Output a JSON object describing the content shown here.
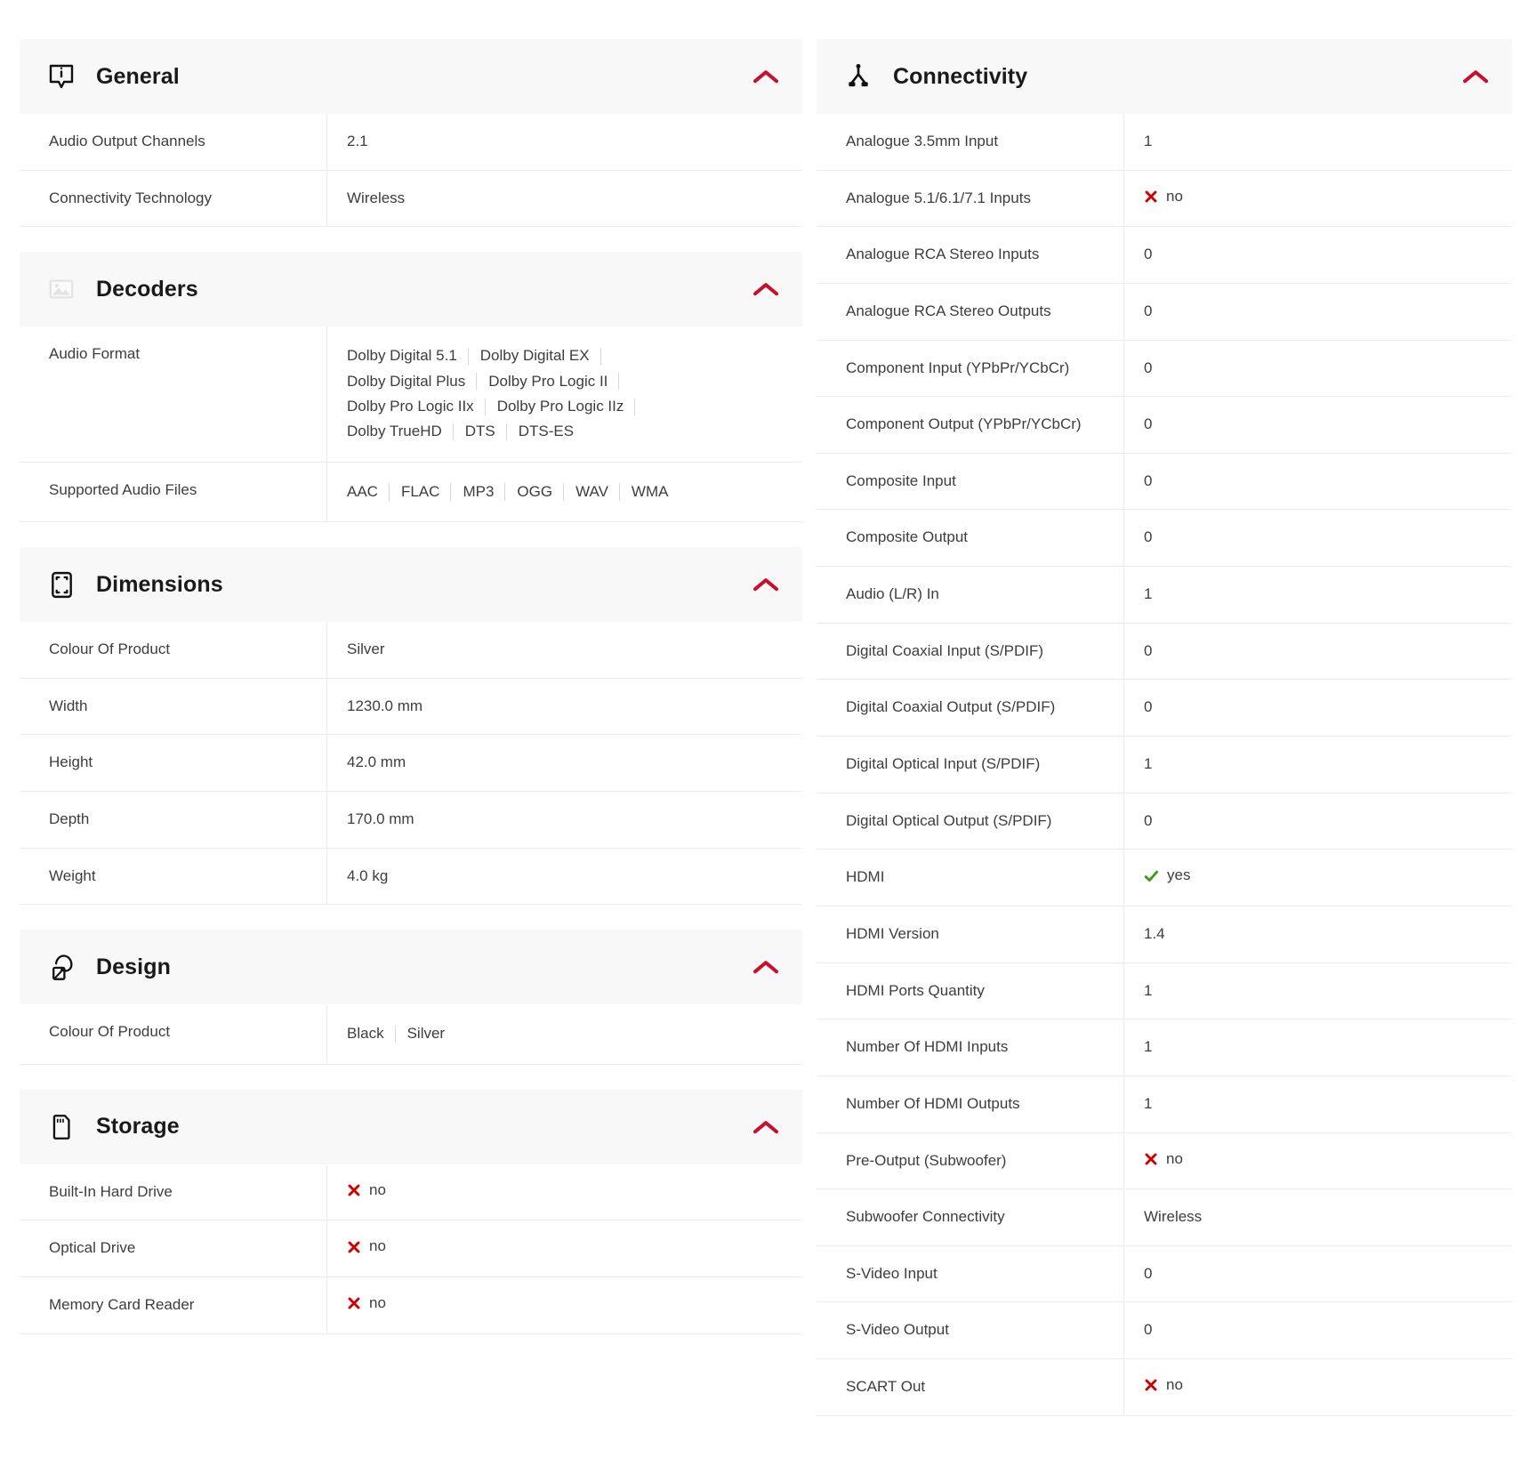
{
  "colors": {
    "accent_red": "#c8102e",
    "no_red": "#cc0000",
    "yes_green": "#3d9c1e",
    "header_bg": "#f8f8f8",
    "text": "#3d3d3d",
    "title": "#1a1a1a",
    "divider": "#ececec"
  },
  "labels": {
    "yes": "yes",
    "no": "no"
  },
  "left_column": [
    {
      "id": "general",
      "title": "General",
      "icon": "info-tooltip-icon",
      "collapse_icon": "chevron-up-icon",
      "rows": [
        {
          "label": "Audio Output Channels",
          "value": "2.1",
          "type": "text"
        },
        {
          "label": "Connectivity Technology",
          "value": "Wireless",
          "type": "text"
        }
      ]
    },
    {
      "id": "decoders",
      "title": "Decoders",
      "icon": "image-placeholder-icon",
      "collapse_icon": "chevron-up-icon",
      "rows": [
        {
          "label": "Audio Format",
          "type": "multi",
          "values": [
            "Dolby Digital 5.1",
            "Dolby Digital EX",
            "Dolby Digital Plus",
            "Dolby Pro Logic II",
            "Dolby Pro Logic IIx",
            "Dolby Pro Logic IIz",
            "Dolby TrueHD",
            "DTS",
            "DTS-ES"
          ]
        },
        {
          "label": "Supported Audio Files",
          "type": "multi",
          "values": [
            "AAC",
            "FLAC",
            "MP3",
            "OGG",
            "WAV",
            "WMA"
          ]
        }
      ]
    },
    {
      "id": "dimensions",
      "title": "Dimensions",
      "icon": "expand-frame-icon",
      "collapse_icon": "chevron-up-icon",
      "rows": [
        {
          "label": "Colour Of Product",
          "value": "Silver",
          "type": "text"
        },
        {
          "label": "Width",
          "value": "1230.0 mm",
          "type": "text"
        },
        {
          "label": "Height",
          "value": "42.0 mm",
          "type": "text"
        },
        {
          "label": "Depth",
          "value": "170.0 mm",
          "type": "text"
        },
        {
          "label": "Weight",
          "value": "4.0 kg",
          "type": "text"
        }
      ]
    },
    {
      "id": "design",
      "title": "Design",
      "icon": "paint-palette-icon",
      "collapse_icon": "chevron-up-icon",
      "rows": [
        {
          "label": "Colour Of Product",
          "type": "multi",
          "values": [
            "Black",
            "Silver"
          ]
        }
      ]
    },
    {
      "id": "storage",
      "title": "Storage",
      "icon": "memory-card-icon",
      "collapse_icon": "chevron-up-icon",
      "rows": [
        {
          "label": "Built-In Hard Drive",
          "value": "no",
          "type": "bool-no"
        },
        {
          "label": "Optical Drive",
          "value": "no",
          "type": "bool-no"
        },
        {
          "label": "Memory Card Reader",
          "value": "no",
          "type": "bool-no"
        }
      ]
    }
  ],
  "right_column": [
    {
      "id": "connectivity",
      "title": "Connectivity",
      "icon": "splitter-connector-icon",
      "collapse_icon": "chevron-up-icon",
      "rows": [
        {
          "label": "Analogue 3.5mm Input",
          "value": "1",
          "type": "text"
        },
        {
          "label": "Analogue 5.1/6.1/7.1 Inputs",
          "value": "no",
          "type": "bool-no"
        },
        {
          "label": "Analogue RCA Stereo Inputs",
          "value": "0",
          "type": "text"
        },
        {
          "label": "Analogue RCA Stereo Outputs",
          "value": "0",
          "type": "text"
        },
        {
          "label": "Component Input (YPbPr/YCbCr)",
          "value": "0",
          "type": "text"
        },
        {
          "label": "Component Output (YPbPr/YCbCr)",
          "value": "0",
          "type": "text"
        },
        {
          "label": "Composite Input",
          "value": "0",
          "type": "text"
        },
        {
          "label": "Composite Output",
          "value": "0",
          "type": "text"
        },
        {
          "label": "Audio (L/R) In",
          "value": "1",
          "type": "text"
        },
        {
          "label": "Digital Coaxial Input (S/PDIF)",
          "value": "0",
          "type": "text"
        },
        {
          "label": "Digital Coaxial Output (S/PDIF)",
          "value": "0",
          "type": "text"
        },
        {
          "label": "Digital Optical Input (S/PDIF)",
          "value": "1",
          "type": "text"
        },
        {
          "label": "Digital Optical Output (S/PDIF)",
          "value": "0",
          "type": "text"
        },
        {
          "label": "HDMI",
          "value": "yes",
          "type": "bool-yes"
        },
        {
          "label": "HDMI Version",
          "value": "1.4",
          "type": "text"
        },
        {
          "label": "HDMI Ports Quantity",
          "value": "1",
          "type": "text"
        },
        {
          "label": "Number Of HDMI Inputs",
          "value": "1",
          "type": "text"
        },
        {
          "label": "Number Of HDMI Outputs",
          "value": "1",
          "type": "text"
        },
        {
          "label": "Pre-Output (Subwoofer)",
          "value": "no",
          "type": "bool-no"
        },
        {
          "label": "Subwoofer Connectivity",
          "value": "Wireless",
          "type": "text"
        },
        {
          "label": "S-Video Input",
          "value": "0",
          "type": "text"
        },
        {
          "label": "S-Video Output",
          "value": "0",
          "type": "text"
        },
        {
          "label": "SCART Out",
          "value": "no",
          "type": "bool-no"
        }
      ]
    }
  ]
}
